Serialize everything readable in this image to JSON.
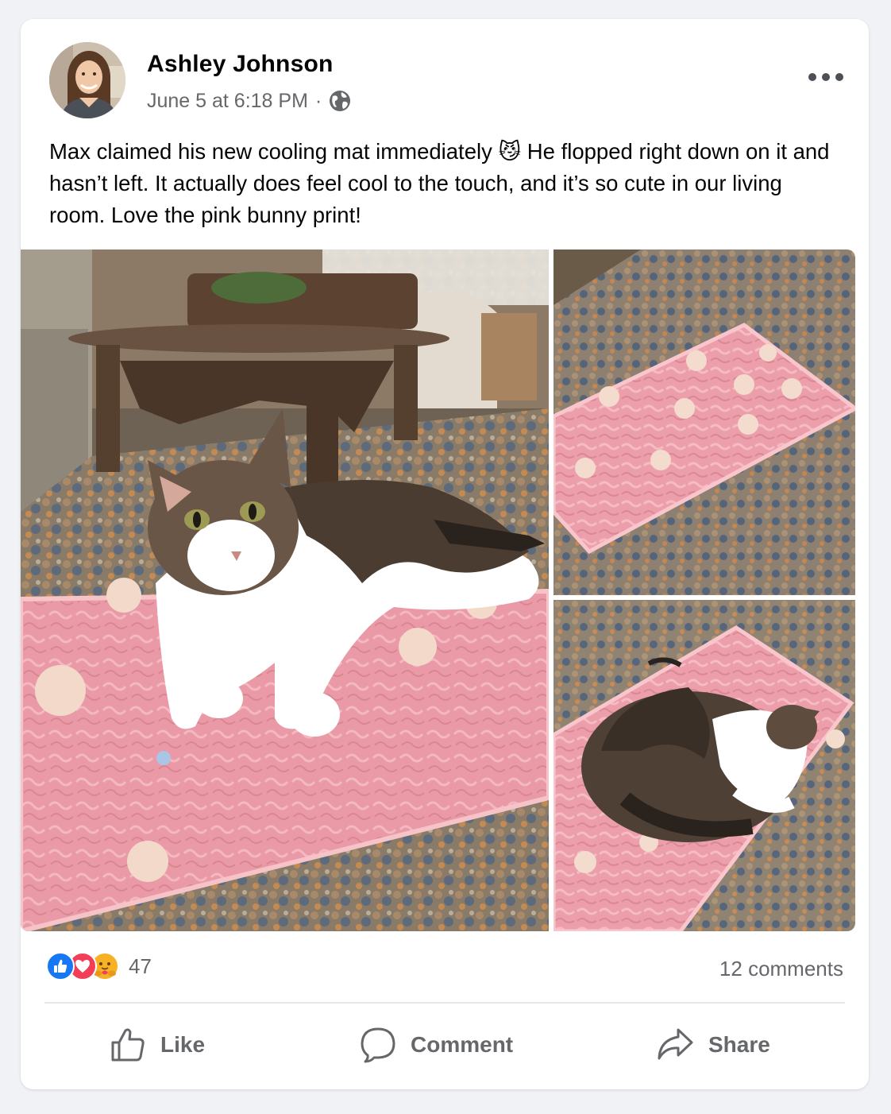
{
  "post": {
    "author": "Ashley Johnson",
    "timestamp": "June 5 at 6:18 PM",
    "separator": "·",
    "audience_icon": "globe-icon",
    "more_icon": "more-options-icon",
    "text": "Max claimed his new cooling mat immediately 😼 He flopped right down on it and hasn’t left. It actually does feel cool to the touch, and it’s so cute in our living room. Love the pink bunny print!"
  },
  "photos": [
    {
      "name": "cat-lying-on-pink-cooling-mat"
    },
    {
      "name": "pink-bunny-cooling-mat-on-rug"
    },
    {
      "name": "cat-sleeping-curled-on-mat"
    }
  ],
  "engagement": {
    "reaction_icons": [
      "like-reaction-icon",
      "love-reaction-icon",
      "care-reaction-icon"
    ],
    "reaction_count": "47",
    "comments": "12 comments"
  },
  "actions": {
    "like": "Like",
    "comment": "Comment",
    "share": "Share"
  },
  "colors": {
    "like_blue": "#1877f2",
    "love_red": "#f33e58",
    "care_yellow": "#f7b125",
    "secondary_text": "#65676b",
    "mat_pink": "#e99aa4"
  }
}
